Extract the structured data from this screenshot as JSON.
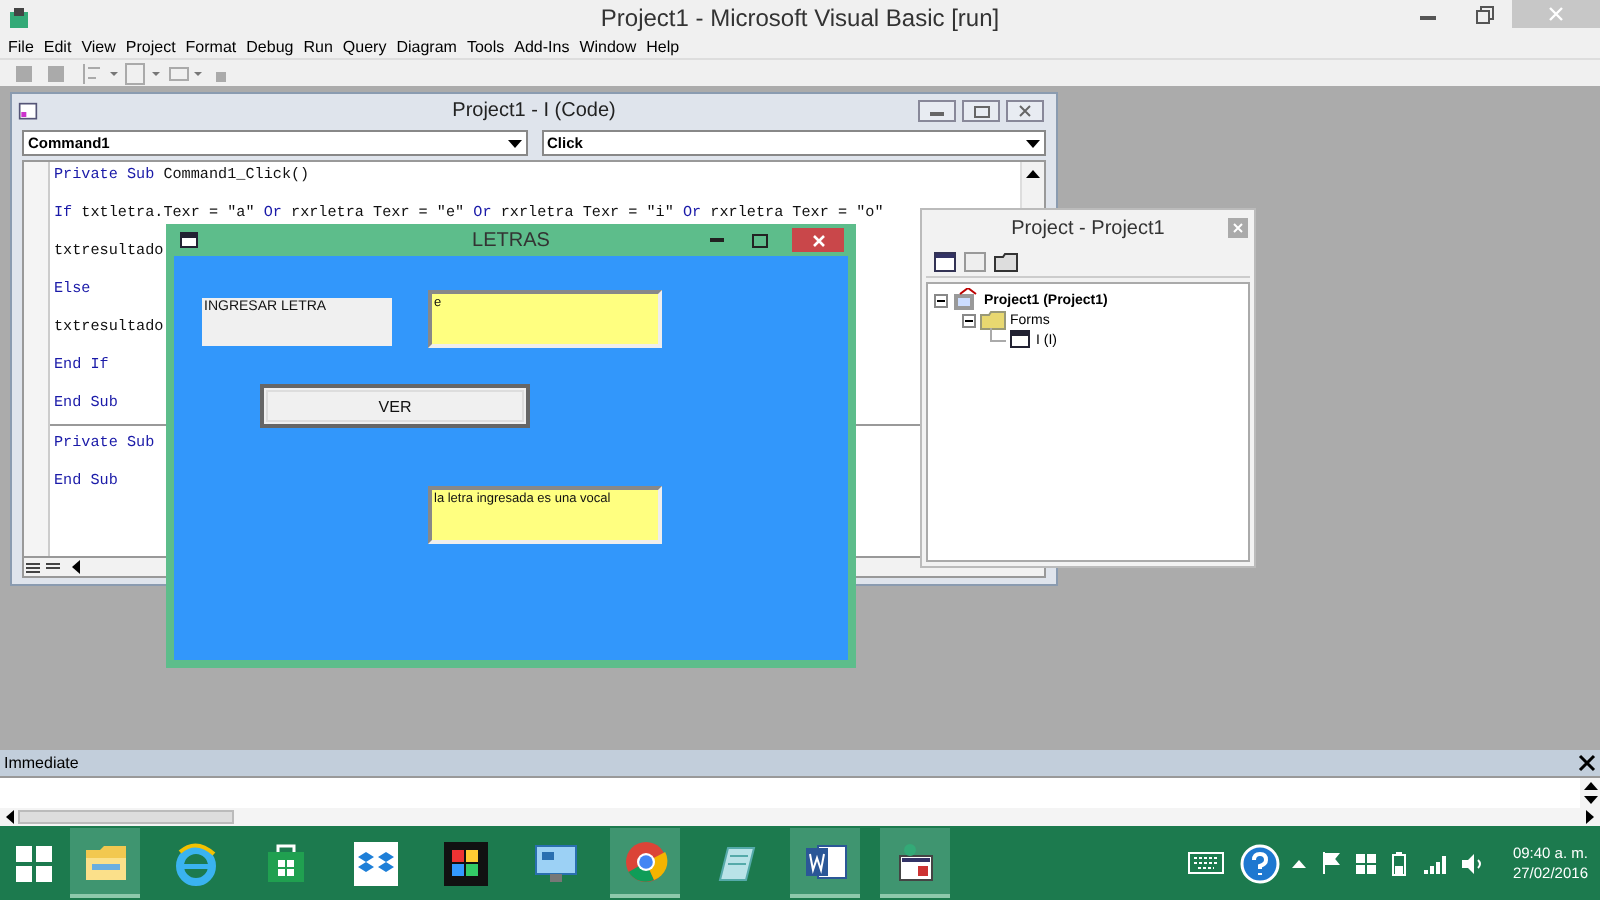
{
  "window": {
    "title": "Project1 - Microsoft Visual Basic [run]"
  },
  "menu": [
    "File",
    "Edit",
    "View",
    "Project",
    "Format",
    "Debug",
    "Run",
    "Query",
    "Diagram",
    "Tools",
    "Add-Ins",
    "Window",
    "Help"
  ],
  "code_window": {
    "title": "Project1 - I (Code)",
    "object": "Command1",
    "procedure": "Click",
    "lines": [
      [
        {
          "text": "Private Sub",
          "kind": "keyword"
        },
        {
          "text": " Command1_Click()",
          "kind": "plain"
        }
      ],
      [
        {
          "text": "If",
          "kind": "keyword"
        },
        {
          "text": " txtletra.Texr = \"a\" ",
          "kind": "plain"
        },
        {
          "text": "Or",
          "kind": "keyword"
        },
        {
          "text": " rxrletra Texr = \"e\" ",
          "kind": "plain"
        },
        {
          "text": "Or",
          "kind": "keyword"
        },
        {
          "text": " rxrletra Texr = \"i\" ",
          "kind": "plain"
        },
        {
          "text": "Or",
          "kind": "keyword"
        },
        {
          "text": " rxrletra Texr = \"o\"",
          "kind": "plain"
        }
      ],
      [
        {
          "text": "txtresultado",
          "kind": "plain"
        }
      ],
      [
        {
          "text": "Else",
          "kind": "keyword"
        }
      ],
      [
        {
          "text": "txtresultado",
          "kind": "plain"
        }
      ],
      [
        {
          "text": "End If",
          "kind": "keyword"
        }
      ],
      [
        {
          "text": "End Sub",
          "kind": "keyword"
        }
      ],
      [
        {
          "text": "Private Sub",
          "kind": "keyword"
        }
      ],
      [
        {
          "text": "End Sub",
          "kind": "keyword"
        }
      ]
    ]
  },
  "form_window": {
    "title": "LETRAS",
    "label": "INGRESAR LETRA",
    "input_value": "e",
    "button": "VER",
    "result_value": "la letra ingresada es una vocal"
  },
  "project_window": {
    "title": "Project - Project1",
    "tree": [
      {
        "label": "Project1 (Project1)",
        "kind": "project",
        "expanded": true,
        "children": [
          {
            "label": "Forms",
            "kind": "folder",
            "expanded": true,
            "children": [
              {
                "label": "I (I)",
                "kind": "form"
              }
            ]
          }
        ]
      }
    ]
  },
  "immediate": {
    "title": "Immediate"
  },
  "taskbar": {
    "apps": [
      {
        "kind": "explorer",
        "open": true
      },
      {
        "kind": "ie",
        "open": false
      },
      {
        "kind": "store",
        "open": false
      },
      {
        "kind": "dropbox",
        "open": false
      },
      {
        "kind": "photos",
        "open": false
      },
      {
        "kind": "remote",
        "open": false
      },
      {
        "kind": "chrome",
        "open": true
      },
      {
        "kind": "notes",
        "open": false
      },
      {
        "kind": "word",
        "open": true
      },
      {
        "kind": "vb",
        "open": true
      }
    ],
    "time": "09:40 a. m.",
    "date": "27/02/2016"
  }
}
